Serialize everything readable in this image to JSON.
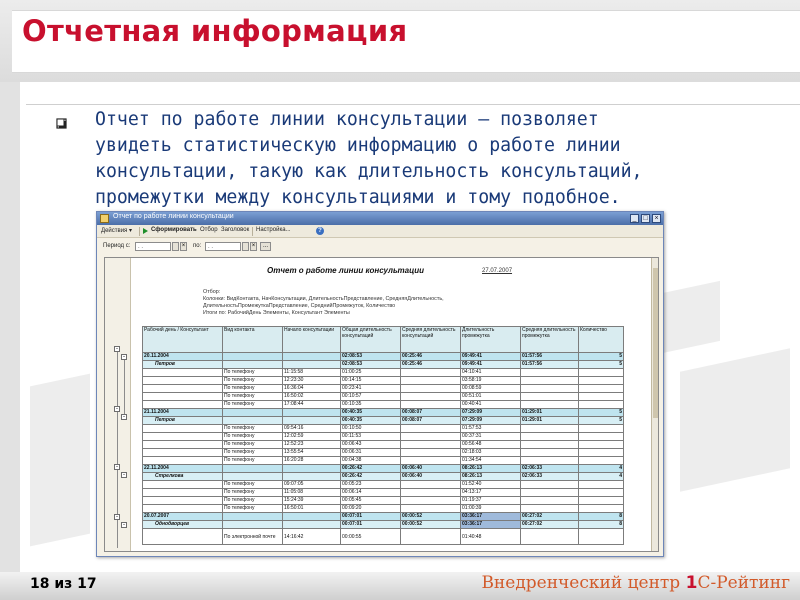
{
  "slide": {
    "title": "Отчетная информация",
    "body": "Отчет по работе линии консультации – позволяет\nувидеть статистическую информацию о работе линии\nконсультации, такую как длительность консультаций,\nпромежутки между консультациями и тому подобное.",
    "page_label": "18 из 17",
    "brand_prefix": "Внедренческий центр ",
    "brand_bold": "1",
    "brand_suffix": "С-Рейтинг",
    "colors": {
      "title": "#c8102e",
      "body_text": "#1a3a78",
      "brand": "#d25a2a"
    }
  },
  "window": {
    "title": "Отчет по работе линии консультации",
    "toolbar": {
      "actions": "Действия ▾",
      "generate": "Сформировать",
      "filter": "Отбор",
      "header": "Заголовок",
      "settings": "Настройка..."
    },
    "period": {
      "from_label": "Период с:",
      "from_value": " .  .",
      "to_label": "по:",
      "to_value": " .  .",
      "more": "..."
    },
    "report": {
      "title": "Отчет о работе линии консультации",
      "date": "27.07.2007",
      "filter_text": "Отбор:\nКолонки: ВидКонтакта, НачКонсультации, ДлительностьПредставление, СредняяДлительность,\nДлительностьПромежуткаПредставление, СреднийПромежуток, Количество\nИтоги по: РабочийДень Элементы, Консультант Элементы",
      "columns": [
        "Рабочий день / Консультант",
        "Вид контакта",
        "Начало консультации",
        "Общая длительность консультаций",
        "Средняя длительность консультаций",
        "Длительность промежутка",
        "Средняя длительность промежутка",
        "Количество"
      ],
      "rows": [
        {
          "type": "g1",
          "cells": [
            "20.11.2004",
            "",
            "",
            "02:08:53",
            "00:25:46",
            "09:49:41",
            "01:57:56",
            "5"
          ]
        },
        {
          "type": "g2",
          "cells": [
            "Петров",
            "",
            "",
            "02:08:53",
            "00:25:46",
            "09:49:41",
            "01:57:56",
            "5"
          ]
        },
        {
          "type": "d",
          "cells": [
            "",
            "По телефону",
            "11:15:58",
            "01:00:25",
            "",
            "04:10:41",
            "",
            ""
          ]
        },
        {
          "type": "d",
          "cells": [
            "",
            "По телефону",
            "12:23:30",
            "00:14:15",
            "",
            "03:58:19",
            "",
            ""
          ]
        },
        {
          "type": "d",
          "cells": [
            "",
            "По телефону",
            "16:36:04",
            "00:23:41",
            "",
            "00:08:59",
            "",
            ""
          ]
        },
        {
          "type": "d",
          "cells": [
            "",
            "По телефону",
            "16:50:02",
            "00:10:57",
            "",
            "00:51:01",
            "",
            ""
          ]
        },
        {
          "type": "d",
          "cells": [
            "",
            "По телефону",
            "17:08:44",
            "00:10:35",
            "",
            "00:40:41",
            "",
            ""
          ]
        },
        {
          "type": "g1",
          "cells": [
            "21.11.2004",
            "",
            "",
            "00:40:35",
            "00:08:07",
            "07:29:09",
            "01:29:01",
            "5"
          ]
        },
        {
          "type": "g2",
          "cells": [
            "Петров",
            "",
            "",
            "00:40:35",
            "00:08:07",
            "07:29:09",
            "01:29:01",
            "5"
          ]
        },
        {
          "type": "d",
          "cells": [
            "",
            "По телефону",
            "09:54:16",
            "00:10:50",
            "",
            "01:57:53",
            "",
            ""
          ]
        },
        {
          "type": "d",
          "cells": [
            "",
            "По телефону",
            "12:02:59",
            "00:11:53",
            "",
            "00:37:31",
            "",
            ""
          ]
        },
        {
          "type": "d",
          "cells": [
            "",
            "По телефону",
            "12:52:23",
            "00:06:43",
            "",
            "00:56:48",
            "",
            ""
          ]
        },
        {
          "type": "d",
          "cells": [
            "",
            "По телефону",
            "13:55:54",
            "00:06:31",
            "",
            "02:18:03",
            "",
            ""
          ]
        },
        {
          "type": "d",
          "cells": [
            "",
            "По телефону",
            "16:20:28",
            "00:04:38",
            "",
            "01:34:54",
            "",
            ""
          ]
        },
        {
          "type": "g1",
          "cells": [
            "22.11.2004",
            "",
            "",
            "00:26:42",
            "00:06:40",
            "08:26:13",
            "02:06:33",
            "4"
          ]
        },
        {
          "type": "g2",
          "cells": [
            "Стрелкова",
            "",
            "",
            "00:26:42",
            "00:06:40",
            "08:26:13",
            "02:06:33",
            "4"
          ]
        },
        {
          "type": "d",
          "cells": [
            "",
            "По телефону",
            "09:07:05",
            "00:05:23",
            "",
            "01:52:40",
            "",
            ""
          ]
        },
        {
          "type": "d",
          "cells": [
            "",
            "По телефону",
            "11:05:08",
            "00:06:14",
            "",
            "04:13:17",
            "",
            ""
          ]
        },
        {
          "type": "d",
          "cells": [
            "",
            "По телефону",
            "15:24:39",
            "00:05:45",
            "",
            "01:19:37",
            "",
            ""
          ]
        },
        {
          "type": "d",
          "cells": [
            "",
            "По телефону",
            "16:50:01",
            "00:09:20",
            "",
            "01:00:39",
            "",
            ""
          ]
        },
        {
          "type": "g1",
          "cells": [
            "20.07.2007",
            "",
            "",
            "00:07:01",
            "00:00:52",
            "03:36:17",
            "00:27:02",
            "8"
          ]
        },
        {
          "type": "g2",
          "cells": [
            "Однодворцев",
            "",
            "",
            "00:07:01",
            "00:00:52",
            "03:36:17",
            "00:27:02",
            "8"
          ]
        },
        {
          "type": "d",
          "tall": true,
          "cells": [
            "",
            "По электронной почте",
            "14:16:42",
            "00:00:55",
            "",
            "01:40:48",
            "",
            ""
          ]
        }
      ]
    }
  }
}
